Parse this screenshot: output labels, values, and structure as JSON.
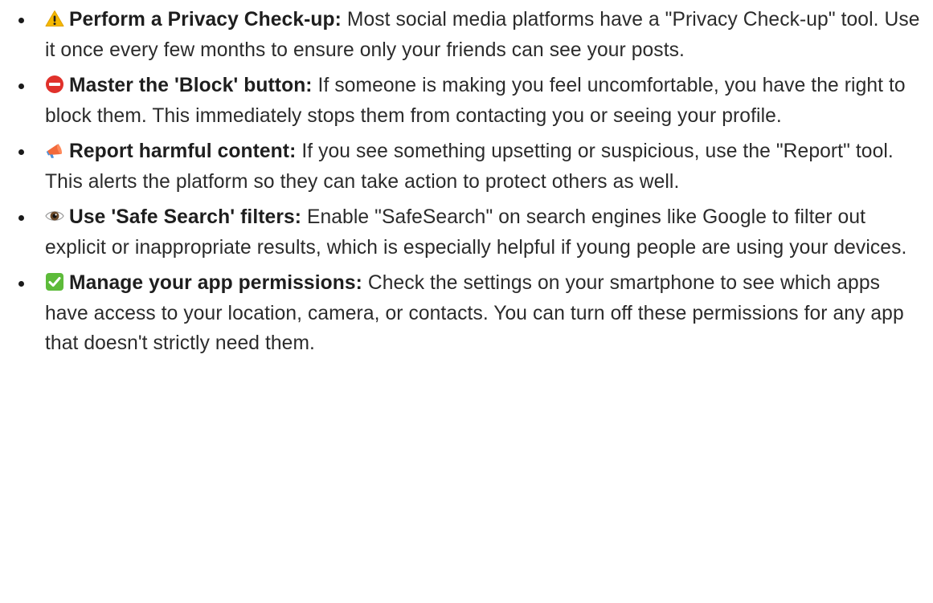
{
  "tips": [
    {
      "icon": "warning-icon",
      "title": "Perform a Privacy Check-up:",
      "body": " Most social media platforms have a \"Privacy Check-up\" tool. Use it once every few months to ensure only your friends can see your posts."
    },
    {
      "icon": "no-entry-icon",
      "title": "Master the 'Block' button:",
      "body": " If someone is making you feel uncomfortable, you have the right to block them. This immediately stops them from contacting you or seeing your profile."
    },
    {
      "icon": "megaphone-icon",
      "title": "Report harmful content:",
      "body": " If you see something upsetting or suspicious, use the \"Report\" tool. This alerts the platform so they can take action to protect others as well."
    },
    {
      "icon": "eye-icon",
      "title": "Use 'Safe Search' filters:",
      "body": " Enable \"SafeSearch\" on search engines like Google to filter out explicit or inappropriate results, which is especially helpful if young people are using your devices."
    },
    {
      "icon": "check-mark-icon",
      "title": "Manage your app permissions:",
      "body": " Check the settings on your smartphone to see which apps have access to your location, camera, or contacts. You can turn off these permissions for any app that doesn't strictly need them."
    }
  ]
}
